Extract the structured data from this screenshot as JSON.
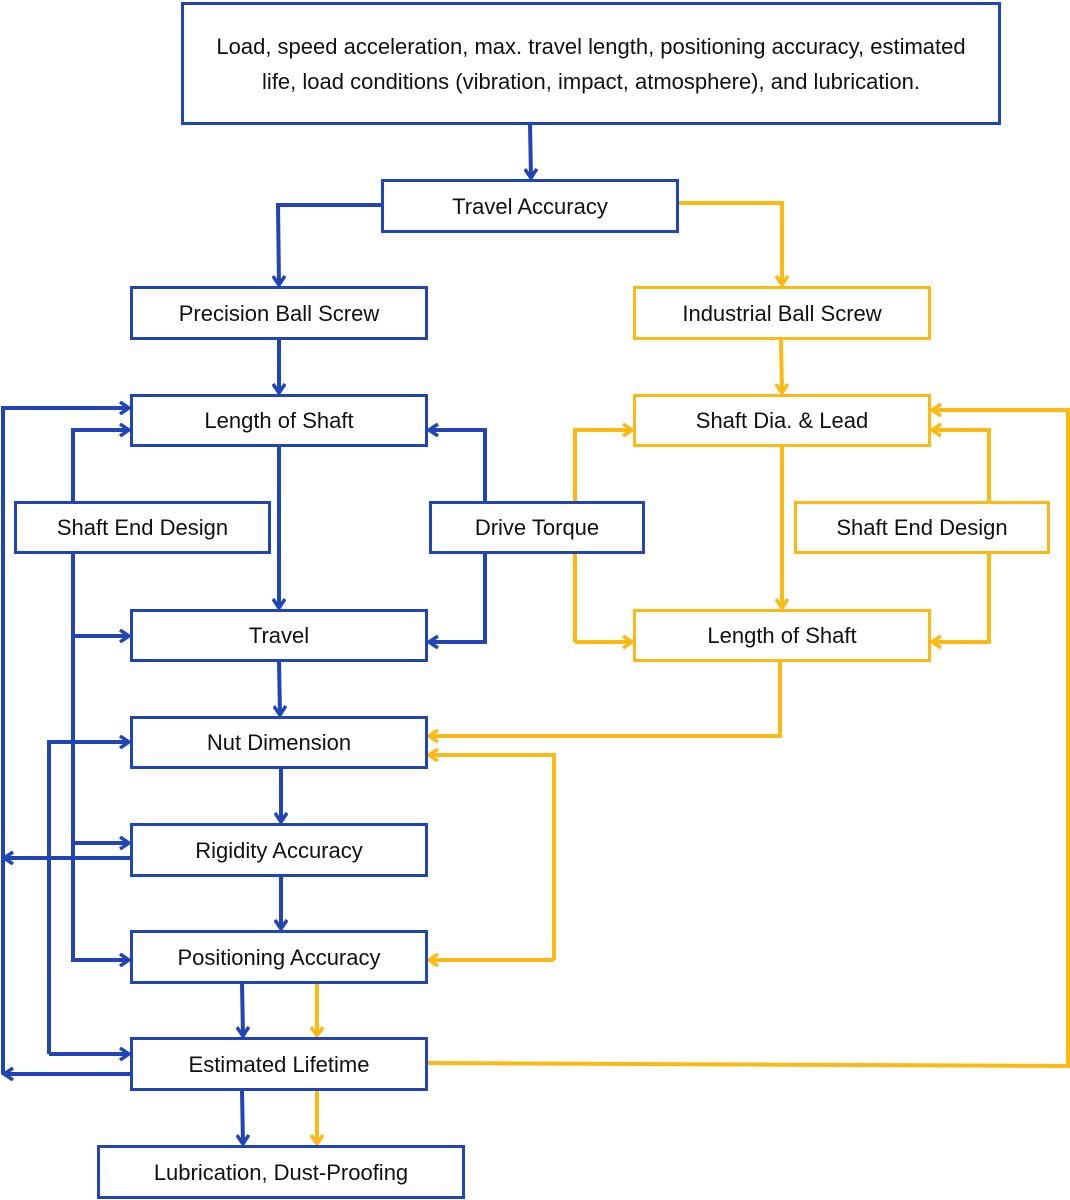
{
  "colors": {
    "blue": "#1f45b8",
    "yellow": "#fdb913"
  },
  "nodes": {
    "requirements": "Load, speed acceleration, max. travel length, positioning accuracy, estimated life, load conditions (vibration, impact, atmosphere), and lubrication.",
    "travel_accuracy": "Travel Accuracy",
    "precision_ball_screw": "Precision Ball Screw",
    "industrial_ball_screw": "Industrial Ball Screw",
    "length_of_shaft_left": "Length of Shaft",
    "shaft_dia_lead": "Shaft Dia. & Lead",
    "shaft_end_design_left": "Shaft End Design",
    "drive_torque": "Drive Torque",
    "shaft_end_design_right": "Shaft End Design",
    "travel": "Travel",
    "length_of_shaft_right": "Length of Shaft",
    "nut_dimension": "Nut Dimension",
    "rigidity_accuracy": "Rigidity Accuracy",
    "positioning_accuracy": "Positioning Accuracy",
    "estimated_lifetime": "Estimated Lifetime",
    "lubrication": "Lubrication, Dust-Proofing"
  }
}
